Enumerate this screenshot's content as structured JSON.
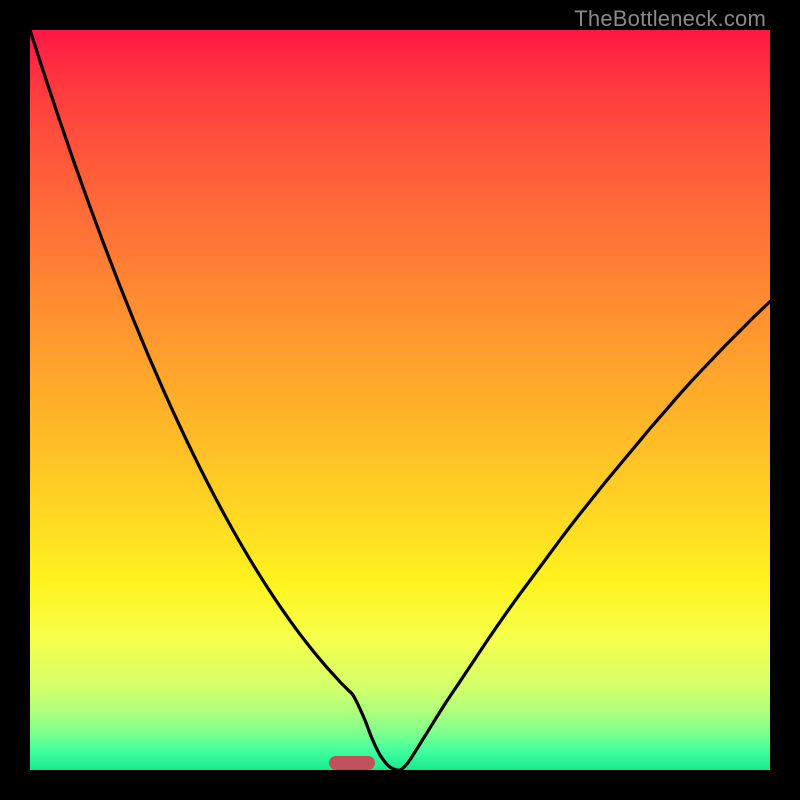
{
  "watermark": "TheBottleneck.com",
  "colors": {
    "curve": "#000000",
    "marker": "#c1515b",
    "frame": "#000000"
  },
  "chart_data": {
    "type": "line",
    "title": "",
    "xlabel": "",
    "ylabel": "",
    "xlim": [
      0,
      100
    ],
    "ylim": [
      0,
      100
    ],
    "x": [
      0,
      2,
      4,
      6,
      8,
      10,
      12,
      14,
      16,
      18,
      20,
      22,
      24,
      26,
      28,
      30,
      32,
      34,
      36,
      38,
      40,
      41,
      42,
      43,
      43.6,
      44.2,
      44.8,
      45.4,
      46,
      46.6,
      47.2,
      47.8,
      48.4,
      49,
      50,
      51,
      52,
      53,
      54,
      56,
      58,
      60,
      62,
      64,
      66,
      68,
      70,
      72,
      74,
      76,
      78,
      80,
      82,
      84,
      86,
      88,
      90,
      92,
      94,
      96,
      98,
      100
    ],
    "values": [
      100,
      93.8,
      87.8,
      82.0,
      76.4,
      71.0,
      65.8,
      60.8,
      56.0,
      51.4,
      47.0,
      42.8,
      38.8,
      35.0,
      31.4,
      28.0,
      24.8,
      21.8,
      19.0,
      16.4,
      14.0,
      12.9,
      11.8,
      10.8,
      10.2,
      9.1,
      7.8,
      6.4,
      4.8,
      3.4,
      2.2,
      1.3,
      0.6,
      0.2,
      0.0,
      0.9,
      2.4,
      4.0,
      5.6,
      8.8,
      11.8,
      14.8,
      17.8,
      20.7,
      23.5,
      26.2,
      28.9,
      31.6,
      34.2,
      36.7,
      39.2,
      41.6,
      44.0,
      46.4,
      48.7,
      51.0,
      53.2,
      55.3,
      57.4,
      59.4,
      61.4,
      63.3
    ],
    "marker": {
      "x": 43.5,
      "width_pct": 6.2
    },
    "notes": "Values estimated from pixel positions; y=0 is bottom of plot filled green, y=100 is top red region."
  }
}
